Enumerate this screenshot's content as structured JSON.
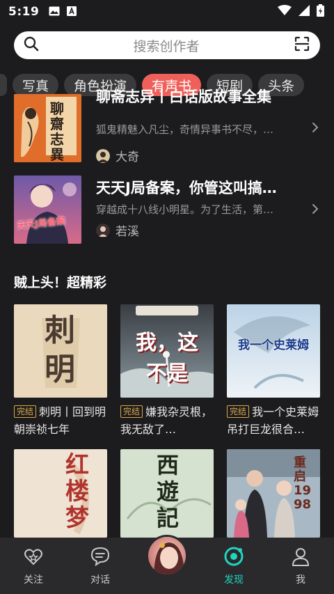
{
  "status_bar": {
    "time": "5:19",
    "left_icons": [
      "image-icon",
      "a-box-icon"
    ],
    "right_icons": [
      "wifi-icon",
      "signal-icon",
      "battery-icon"
    ]
  },
  "search": {
    "placeholder": "搜索创作者",
    "left_icon": "search-icon",
    "right_icon": "scan-icon"
  },
  "tabs": [
    {
      "label": "写真",
      "active": false
    },
    {
      "label": "角色扮演",
      "active": false
    },
    {
      "label": "有声书",
      "active": true
    },
    {
      "label": "短剧",
      "active": false
    },
    {
      "label": "头条",
      "active": false
    }
  ],
  "list": [
    {
      "title": "聊斋志异丨白话版故事全集",
      "desc": "狐鬼精魅入凡尘，奇情异事书不尽，…",
      "author": "大奇",
      "cover_text": "聊齋志異"
    },
    {
      "title": "天天J局备案，你管这叫搞…",
      "desc": "穿越成十八线小明星。为了生活，第…",
      "author": "若溪",
      "cover_text": "天天J局备案"
    }
  ],
  "section": {
    "title": "贼上头！超精彩"
  },
  "grid": [
    {
      "badge": "完结",
      "title": "刺明丨回到明朝崇祯七年",
      "cover_text": "刺明"
    },
    {
      "badge": "完结",
      "title": "嫌我杂灵根，我无敌了…",
      "cover_text": "我，这不是"
    },
    {
      "badge": "完结",
      "title": "我一个史莱姆吊打巨龙很合…",
      "cover_text": "我一个史莱姆"
    },
    {
      "badge": "",
      "title": "",
      "cover_text": "红楼梦"
    },
    {
      "badge": "",
      "title": "",
      "cover_text": "西遊記"
    },
    {
      "badge": "",
      "title": "",
      "cover_text": "重启1998"
    }
  ],
  "bottom_nav": [
    {
      "label": "关注",
      "icon": "heart-star-icon",
      "active": false
    },
    {
      "label": "对话",
      "icon": "chat-bubble-icon",
      "active": false
    },
    {
      "label": "发现",
      "icon": "discover-icon",
      "active": true
    },
    {
      "label": "我",
      "icon": "person-icon",
      "active": false
    }
  ],
  "colors": {
    "background": "#1c1c1e",
    "tab_active": "#f0605a",
    "nav_active": "#1fd6c1",
    "badge": "#e0aa4a"
  }
}
